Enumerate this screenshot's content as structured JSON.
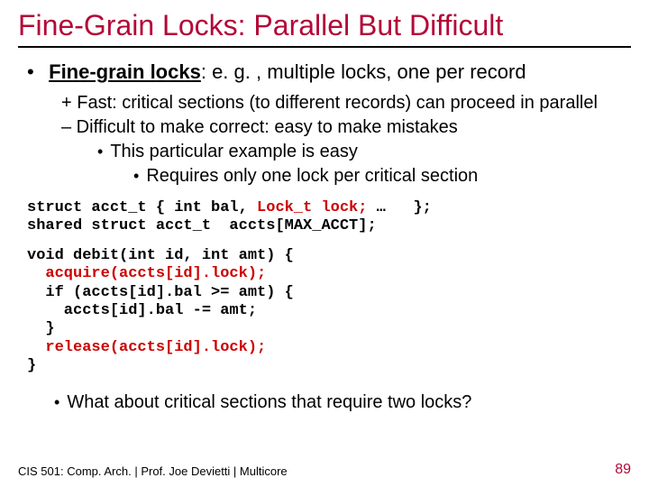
{
  "title": "Fine-Grain Locks: Parallel But Difficult",
  "main": {
    "term": "Fine-grain locks",
    "rest": ": e. g. , multiple locks, one per record"
  },
  "points": {
    "plus": "+ Fast: critical sections (to different records) can proceed in parallel",
    "minus": "– Difficult to make correct: easy to make mistakes",
    "sub1": "This particular example is easy",
    "sub2": "Requires only one lock per critical section"
  },
  "code1_a": "struct acct_t { int bal,",
  "code1_b": " Lock_t lock;",
  "code1_c": " …   };",
  "code2": "shared struct acct_t  accts[MAX_ACCT];",
  "func1": "void debit(int id, int amt) {",
  "func2": "  acquire(accts[id].lock);",
  "func3": "  if (accts[id].bal >= amt) {",
  "func4": "    accts[id].bal -= amt;",
  "func5": "  }",
  "func6": "  release(accts[id].lock);",
  "func7": "}",
  "question": "What about critical sections that require two locks?",
  "footer": "CIS 501: Comp. Arch.  |  Prof. Joe Devietti  |  Multicore",
  "page": "89"
}
